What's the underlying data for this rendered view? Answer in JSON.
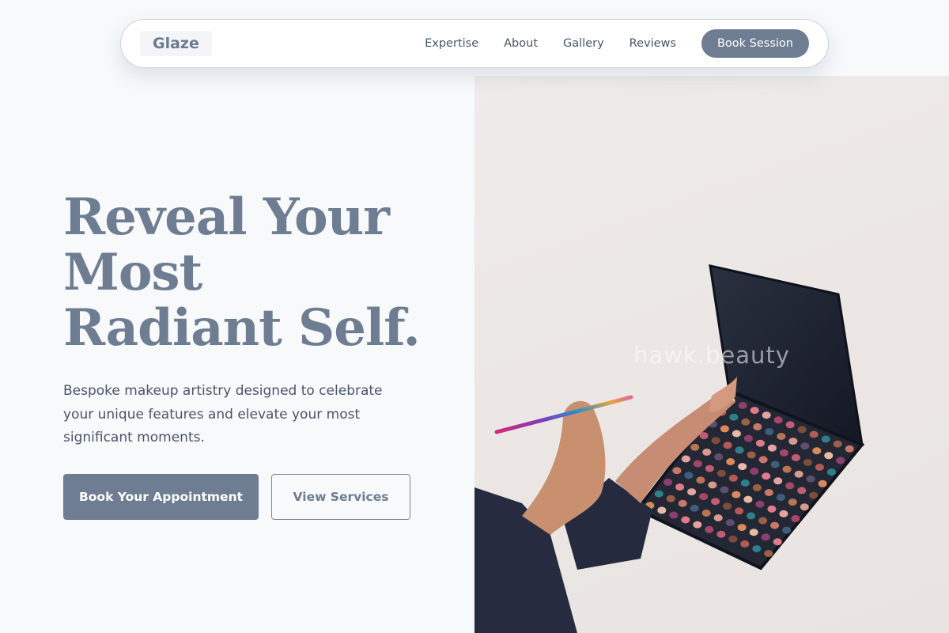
{
  "nav": {
    "logo": "Glaze",
    "links": [
      "Expertise",
      "About",
      "Gallery",
      "Reviews"
    ],
    "cta": "Book Session"
  },
  "hero": {
    "title_lines": [
      "Reveal Your",
      "Most",
      "Radiant Self."
    ],
    "subtitle": "Bespoke makeup artistry designed to celebrate your unique features and elevate your most significant moments.",
    "primary_button": "Book Your Appointment",
    "secondary_button": "View Services",
    "image": {
      "watermark": "hawk.beauty",
      "subject": "hand holding an eyeshadow palette and makeup brush"
    }
  },
  "colors": {
    "accent": "#6e7d91",
    "background": "#f7f9fb",
    "text": "#4a5568"
  }
}
